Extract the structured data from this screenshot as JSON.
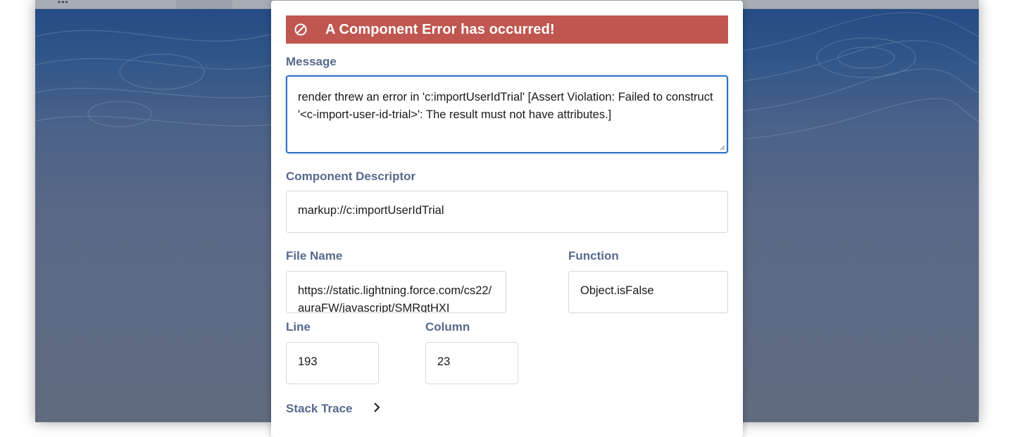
{
  "error": {
    "icon": "ban-icon",
    "title": "A Component Error has occurred!",
    "banner_color": "#c05650"
  },
  "message": {
    "label": "Message",
    "value": "render threw an error in 'c:importUserIdTrial' [Assert Violation: Failed to construct '<c-import-user-id-trial>': The result must not have attributes.]"
  },
  "descriptor": {
    "label": "Component Descriptor",
    "value": "markup://c:importUserIdTrial"
  },
  "file": {
    "label": "File Name",
    "value": "https://static.lightning.force.com/cs22/auraFW/javascript/SMRgtHXI"
  },
  "function": {
    "label": "Function",
    "value": "Object.isFalse"
  },
  "line": {
    "label": "Line",
    "value": "193"
  },
  "column": {
    "label": "Column",
    "value": "23"
  },
  "stack": {
    "label": "Stack Trace",
    "icon": "chevron-right-icon"
  },
  "colors": {
    "label_text": "#56698d",
    "focus_border": "#2f70c6",
    "backdrop": "#5b6986"
  }
}
